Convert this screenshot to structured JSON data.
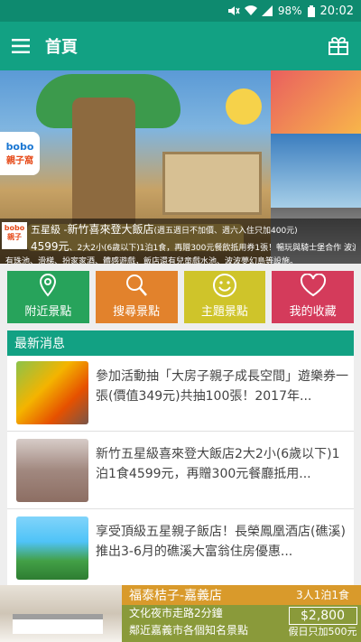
{
  "status_bar": {
    "battery": "98%",
    "time": "20:02"
  },
  "app_bar": {
    "title": "首頁"
  },
  "banner": {
    "logo_text": "bobo",
    "logo_sub": "親子窩",
    "caption_line1_prefix": "五星級 -",
    "caption_hotel": "新竹喜來登大飯店",
    "caption_note": "(週五週日不加價、週六入住只加400元)",
    "caption_price": "4599元",
    "caption_line2": "、2大2小(6歲以下)1泊1食，再贈300元餐飲抵用券1張！暢玩與騎士堡合作 波波叢林遊戲",
    "caption_line3": "有珠池、滑梯、扮家家酒、體感遊戲，飯店還有兒童戲水池、波波夢幻島等設施。"
  },
  "tiles": [
    {
      "label": "附近景點",
      "icon": "map-pin-icon"
    },
    {
      "label": "搜尋景點",
      "icon": "search-icon"
    },
    {
      "label": "主題景點",
      "icon": "smile-icon"
    },
    {
      "label": "我的收藏",
      "icon": "heart-icon"
    }
  ],
  "news": {
    "header": "最新消息",
    "items": [
      {
        "text": "參加活動抽「大房子親子成長空間」遊樂券一張(價值349元)共抽100張！2017年..."
      },
      {
        "text": "新竹五星級喜來登大飯店2大2小(6歲以下)1泊1食4599元，再贈300元餐廳抵用..."
      },
      {
        "text": "享受頂級五星親子飯店！長榮鳳凰酒店(礁溪)推出3-6月的礁溪大富翁住房優惠..."
      }
    ]
  },
  "ad": {
    "name": "福泰桔子-嘉義店",
    "line2": "文化夜市走路2分鐘",
    "line3": "鄰近嘉義市各個知名景點",
    "package": "3人1泊1食",
    "price": "$2,800",
    "note": "假日只加500元"
  },
  "colors": {
    "primary": "#12a183",
    "status": "#0e8a6f",
    "tile_nearby": "#27a35b",
    "tile_search": "#e2822c",
    "tile_theme": "#cfc42a",
    "tile_favorites": "#d43b5b"
  }
}
